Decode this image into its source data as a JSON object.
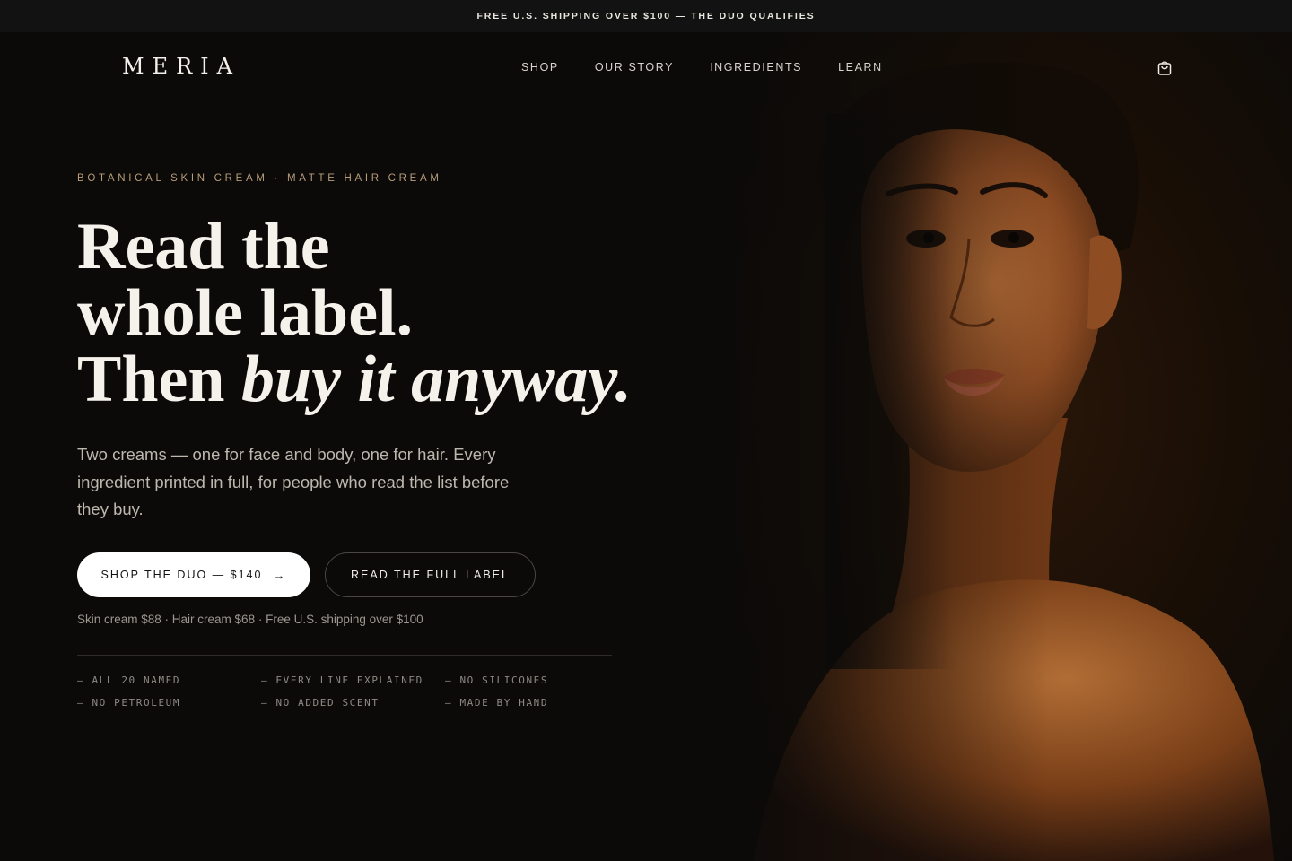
{
  "announcement": "FREE U.S. SHIPPING OVER $100 — THE DUO QUALIFIES",
  "brand": {
    "logo": "MERIA"
  },
  "nav": {
    "links": [
      "SHOP",
      "OUR STORY",
      "INGREDIENTS",
      "LEARN"
    ],
    "cart_icon": "bag-icon"
  },
  "hero": {
    "eyebrow": "BOTANICAL SKIN CREAM · MATTE HAIR CREAM",
    "headline": {
      "line1": "Read the",
      "line2": "whole label.",
      "line3_plain": "Then ",
      "line3_italic": "buy it anyway."
    },
    "lede": "Two creams — one for face and body, one for hair. Every ingredient printed in full, for people who read the list before they buy.",
    "primary_cta": "SHOP THE DUO — $140",
    "secondary_cta": "READ THE FULL LABEL",
    "pricing_note": "Skin cream $88 · Hair cream $68 · Free U.S. shipping over $100",
    "claims": [
      "— ALL 20 NAMED",
      "— EVERY LINE EXPLAINED",
      "— NO SILICONES",
      "— NO PETROLEUM",
      "— NO ADDED SCENT",
      "— MADE BY HAND"
    ]
  },
  "colors": {
    "background": "#0b0a09",
    "announcement_bar": "#121212",
    "accent_eyebrow": "#b89d7a",
    "primary_button": "#ffffff"
  }
}
